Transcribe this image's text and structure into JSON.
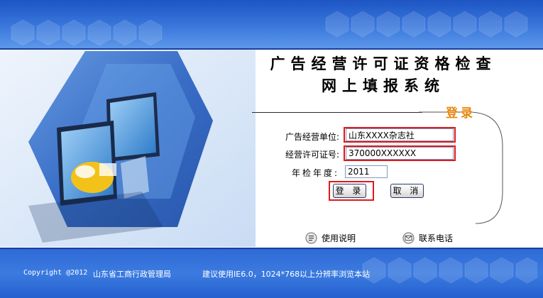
{
  "header": {
    "title_line1": "广告经营许可证资格检查",
    "title_line2": "网上填报系统"
  },
  "login": {
    "heading": "登录",
    "unit_label": "广告经营单位:",
    "unit_value": "山东XXXX杂志社",
    "license_label": "经营许可证号:",
    "license_value": "370000XXXXXX",
    "year_label": "年检年度:",
    "year_value": "2011",
    "login_button": "登 录",
    "cancel_button": "取 消"
  },
  "links": {
    "help": "使用说明",
    "contact": "联系电话"
  },
  "footer": {
    "copyright": "Copyright @2012",
    "org": "山东省工商行政管理局",
    "hint": "建议使用IE6.0，1024*768以上分辨率浏览本站"
  },
  "colors": {
    "banner_blue": "#3a78dc",
    "heading_orange": "#e8870f",
    "highlight_red": "#e0181e"
  }
}
